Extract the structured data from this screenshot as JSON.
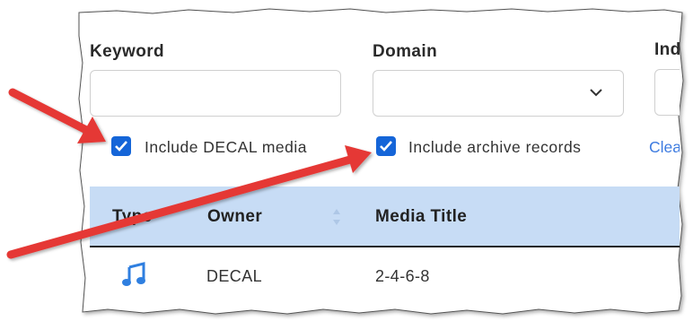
{
  "filters": {
    "keyword_label": "Keyword",
    "keyword_value": "",
    "domain_label": "Domain",
    "domain_value": "",
    "third_label_partial": "Indi",
    "include_decal_label": "Include DECAL media",
    "include_decal_checked": true,
    "include_archive_label": "Include archive records",
    "include_archive_checked": true,
    "clear_partial": "Clea"
  },
  "table": {
    "headers": [
      "Type",
      "Owner",
      "Media Title"
    ],
    "rows": [
      {
        "type_icon": "music-note-icon",
        "owner": "DECAL",
        "media_title": "2-4-6-8"
      }
    ]
  },
  "colors": {
    "checkbox": "#1565d8",
    "header_bg": "#c7dcf5",
    "link": "#3d7be0",
    "arrow": "#e53935",
    "type_icon": "#2f7fe0"
  }
}
